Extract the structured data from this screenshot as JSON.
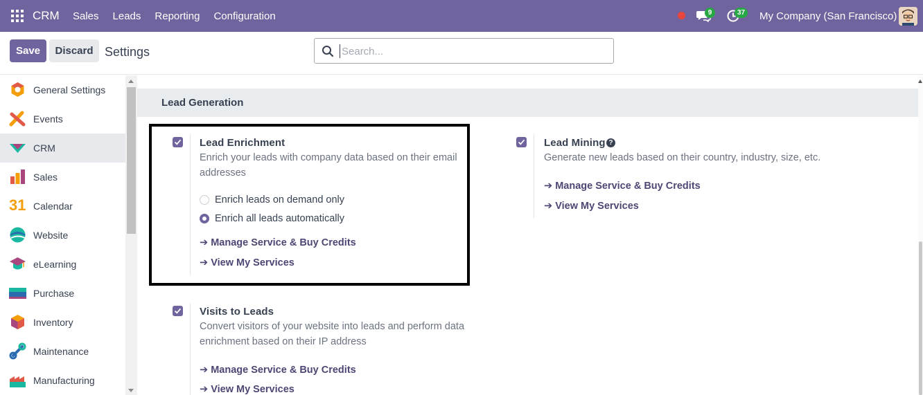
{
  "navbar": {
    "brand": "CRM",
    "menu": [
      "Sales",
      "Leads",
      "Reporting",
      "Configuration"
    ],
    "chat_count": "9",
    "activity_count": "37",
    "company": "My Company (San Francisco)"
  },
  "control": {
    "save_label": "Save",
    "discard_label": "Discard",
    "title": "Settings",
    "search_placeholder": "Search..."
  },
  "sidebar": {
    "items": [
      {
        "label": "General Settings",
        "icon": "general-settings-icon"
      },
      {
        "label": "Events",
        "icon": "events-icon"
      },
      {
        "label": "CRM",
        "icon": "crm-icon",
        "active": true
      },
      {
        "label": "Sales",
        "icon": "sales-icon"
      },
      {
        "label": "Calendar",
        "icon": "calendar-icon",
        "icon_text": "31"
      },
      {
        "label": "Website",
        "icon": "website-icon"
      },
      {
        "label": "eLearning",
        "icon": "elearning-icon"
      },
      {
        "label": "Purchase",
        "icon": "purchase-icon"
      },
      {
        "label": "Inventory",
        "icon": "inventory-icon"
      },
      {
        "label": "Maintenance",
        "icon": "maintenance-icon"
      },
      {
        "label": "Manufacturing",
        "icon": "manufacturing-icon"
      }
    ]
  },
  "main": {
    "section_title": "Lead Generation",
    "lead_enrichment": {
      "title": "Lead Enrichment",
      "desc_line1": "Enrich your leads with company data based on their email",
      "desc_line2": "addresses",
      "checked": true,
      "options": [
        {
          "label": "Enrich leads on demand only",
          "selected": false
        },
        {
          "label": "Enrich all leads automatically",
          "selected": true
        }
      ],
      "link1": "Manage Service & Buy Credits",
      "link2": "View My Services"
    },
    "lead_mining": {
      "title": "Lead Mining",
      "desc": "Generate new leads based on their country, industry, size, etc.",
      "checked": true,
      "link1": "Manage Service & Buy Credits",
      "link2": "View My Services"
    },
    "visits_to_leads": {
      "title": "Visits to Leads",
      "desc_line1": "Convert visitors of your website into leads and perform data",
      "desc_line2": "enrichment based on their IP address",
      "checked": true,
      "link1": "Manage Service & Buy Credits",
      "link2": "View My Services"
    }
  },
  "colors": {
    "brand": "#71639e",
    "link": "#4c4775",
    "badge": "#28a745",
    "record": "#e8453c"
  }
}
